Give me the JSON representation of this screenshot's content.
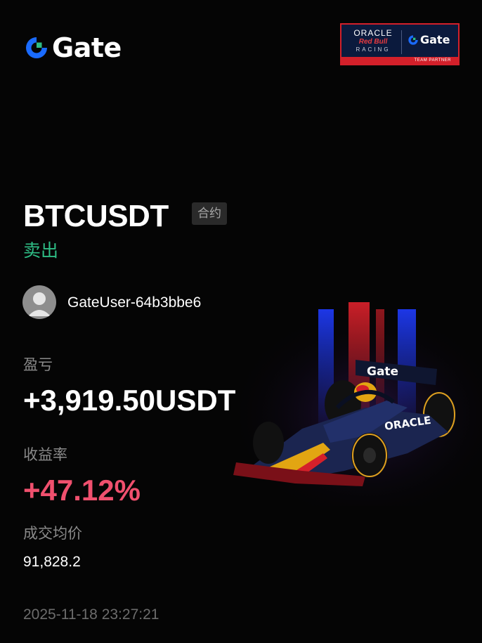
{
  "brand": {
    "name": "Gate",
    "icon": "gate-logo-icon",
    "colors": {
      "primary": "#1a6bff",
      "accent": "#2ebd85"
    }
  },
  "partner_badge": {
    "oracle": "ORACLE",
    "redbull": "Red Bull",
    "racing": "RACING",
    "gate": "Gate",
    "footer": "TEAM PARTNER",
    "border_color": "#d3202a"
  },
  "trade": {
    "pair": "BTCUSDT",
    "contract_tag": "合约",
    "side": "卖出",
    "side_color": "#2ebd85"
  },
  "user": {
    "name": "GateUser-64b3bbe6",
    "avatar_icon": "avatar-icon"
  },
  "stats": {
    "pnl_label": "盈亏",
    "pnl_value": "+3,919.50USDT",
    "roi_label": "收益率",
    "roi_value": "+47.12%",
    "roi_color": "#f0506e",
    "avg_price_label": "成交均价",
    "avg_price_value": "91,828.2"
  },
  "timestamp": "2025-11-18 23:27:21",
  "artwork": {
    "car_icon": "f1-car-icon",
    "car_livery_text": "Gate",
    "car_sponsor_text": "ORACLE"
  }
}
